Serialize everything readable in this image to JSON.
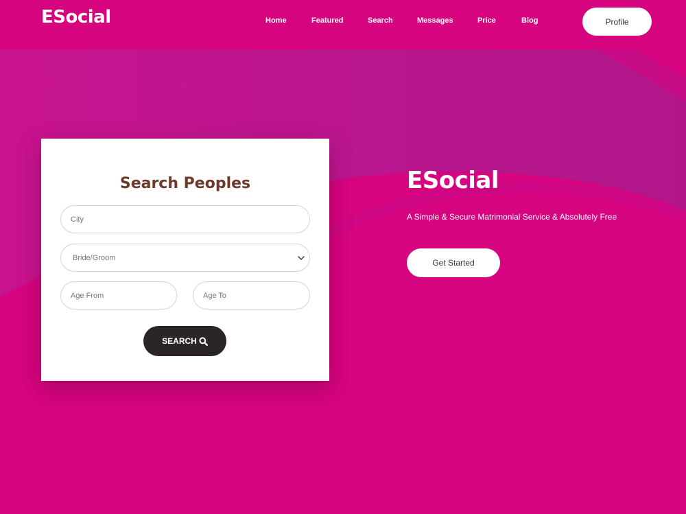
{
  "header": {
    "logo": "ESocial",
    "nav": [
      "Home",
      "Featured",
      "Search",
      "Messages",
      "Price",
      "Blog"
    ],
    "profile_label": "Profile"
  },
  "search_card": {
    "title": "Search Peoples",
    "city_placeholder": "City",
    "bride_groom_selected": "Bride/Groom",
    "age_from_placeholder": "Age From",
    "age_to_placeholder": "Age To",
    "search_label": "SEARCH",
    "search_icon": "magnifier-icon"
  },
  "hero": {
    "title": "ESocial",
    "subtitle": "A Simple & Secure Matrimonial Service & Absolutely Free",
    "cta_label": "Get Started"
  },
  "colors": {
    "brand": "#d6047f",
    "card_title": "#6b3a2a",
    "button_dark": "#2b2527"
  }
}
